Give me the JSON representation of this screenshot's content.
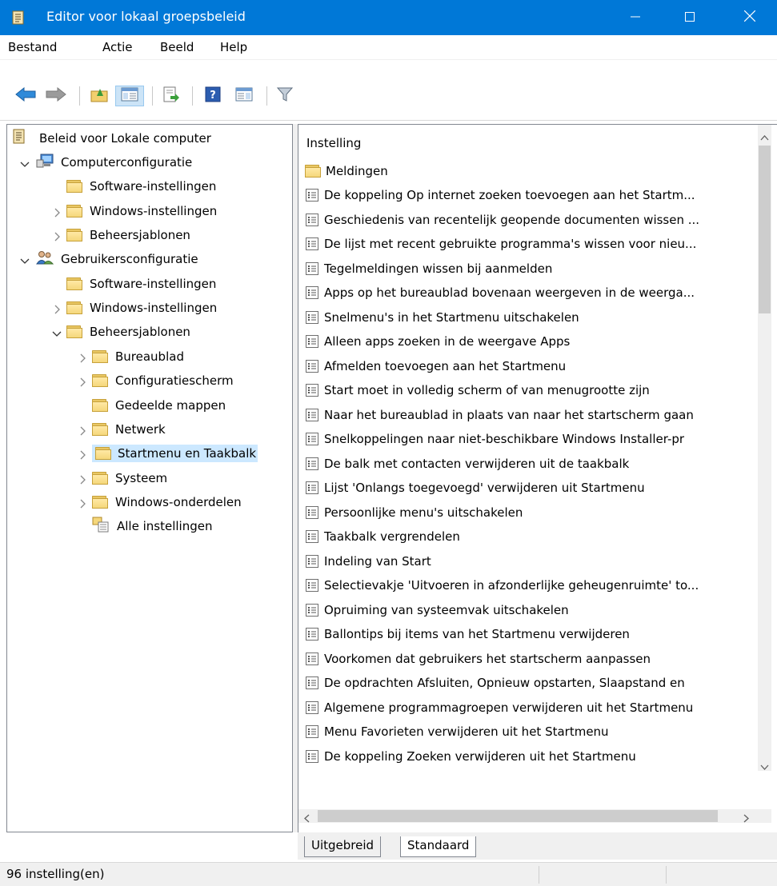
{
  "window": {
    "title": "Editor voor lokaal groepsbeleid",
    "controls": {
      "minimize": "minimize-icon",
      "maximize": "maximize-icon",
      "close": "close-icon"
    },
    "accent": "#0078d7"
  },
  "menu": {
    "file": "Bestand",
    "action": "Actie",
    "view": "Beeld",
    "help": "Help"
  },
  "toolbar": {
    "icons": [
      "back-arrow-icon",
      "forward-arrow-icon",
      "up-folder-icon",
      "show-hide-tree-icon",
      "export-list-icon",
      "help-icon",
      "properties-view-icon",
      "filter-icon"
    ]
  },
  "tree": {
    "root": "Beleid voor Lokale computer",
    "computer_config": "Computerconfiguratie",
    "cc_software": "Software-instellingen",
    "cc_windows": "Windows-instellingen",
    "cc_admin": "Beheersjablonen",
    "user_config": "Gebruikersconfiguratie",
    "uc_software": "Software-instellingen",
    "uc_windows": "Windows-instellingen",
    "uc_admin": "Beheersjablonen",
    "desktop": "Bureaublad",
    "control_panel": "Configuratiescherm",
    "shared_folders": "Gedeelde mappen",
    "network": "Netwerk",
    "start_taskbar": "Startmenu en Taakbalk",
    "system": "Systeem",
    "windows_components": "Windows-onderdelen",
    "all_settings": "Alle instellingen"
  },
  "list": {
    "header": "Instelling",
    "folder_item": "Meldingen",
    "items": [
      "De koppeling Op internet zoeken toevoegen aan het Startm...",
      "Geschiedenis van recentelijk geopende documenten wissen ...",
      "De lijst met recent gebruikte programma's wissen voor nieu...",
      "Tegelmeldingen wissen bij aanmelden",
      "Apps op het bureaublad bovenaan weergeven in de weerga...",
      "Snelmenu's in het Startmenu uitschakelen",
      "Alleen apps zoeken in de weergave Apps",
      "Afmelden toevoegen aan het Startmenu",
      "Start moet in volledig scherm of van menugrootte zijn",
      "Naar het bureaublad in plaats van naar het startscherm gaan",
      "Snelkoppelingen naar niet-beschikbare Windows Installer-pr",
      "De balk met contacten verwijderen uit de taakbalk",
      "Lijst 'Onlangs toegevoegd' verwijderen uit Startmenu",
      "Persoonlijke menu's uitschakelen",
      "Taakbalk vergrendelen",
      "Indeling van Start",
      "Selectievakje 'Uitvoeren in afzonderlijke geheugenruimte' to...",
      "Opruiming van systeemvak uitschakelen",
      "Ballontips bij items van het Startmenu verwijderen",
      "Voorkomen dat gebruikers het startscherm aanpassen",
      "De opdrachten Afsluiten, Opnieuw opstarten, Slaapstand en",
      "Algemene programmagroepen verwijderen uit het Startmenu",
      "Menu Favorieten verwijderen uit het Startmenu",
      "De koppeling Zoeken verwijderen uit het Startmenu"
    ]
  },
  "tabs": {
    "extended": "Uitgebreid",
    "standard": "Standaard"
  },
  "status": {
    "text": "96 instelling(en)"
  }
}
